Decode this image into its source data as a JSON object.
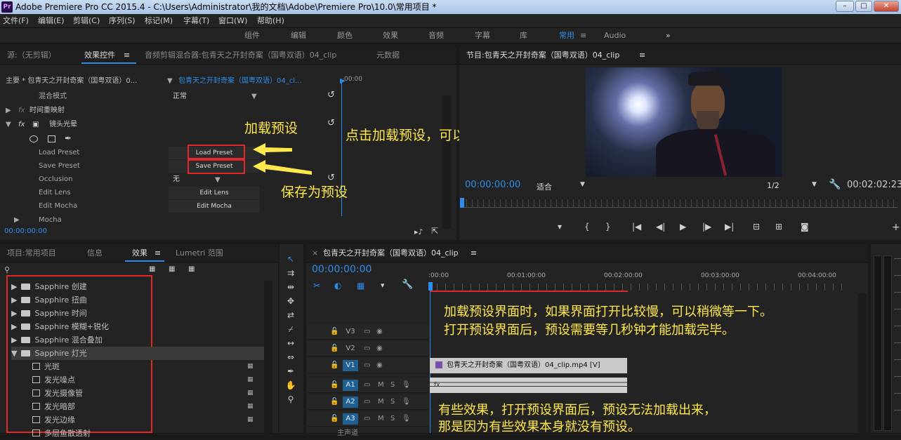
{
  "window": {
    "title": "Adobe Premiere Pro CC 2015.4 - C:\\Users\\Administrator\\我的文档\\Adobe\\Premiere Pro\\10.0\\常用项目 *",
    "logo": "Pr",
    "min": "–",
    "max": "□",
    "close": "✕"
  },
  "menu": [
    "文件(F)",
    "编辑(E)",
    "剪辑(C)",
    "序列(S)",
    "标记(M)",
    "字幕(T)",
    "窗口(W)",
    "帮助(H)"
  ],
  "workspaces": [
    "组件",
    "编辑",
    "颜色",
    "效果",
    "音频",
    "字幕",
    "库",
    "常用",
    "Audio",
    "»"
  ],
  "workspace_active": "常用",
  "top_left": {
    "tabs": [
      "源:（无剪辑）",
      "效果控件",
      "音频剪辑混合器:包青天之开封奇案（国粤双语）04_clip",
      "元数据"
    ],
    "tab_menu": "≡",
    "master_label": "主要 * 包青天之开封奇案（国粤双语）0...",
    "clip_label": "包青天之开封奇案（国粤双语）04_cl...",
    "ruler_time": "00:00",
    "rows": {
      "blend": "混合模式",
      "blend_val": "正常",
      "time_remap": "时间重映射",
      "lens_flare": "镜头光晕",
      "load_preset": "Load Preset",
      "save_preset": "Save Preset",
      "occlusion": "Occlusion",
      "occlusion_val": "无",
      "edit_lens": "Edit Lens",
      "edit_mocha": "Edit Mocha",
      "mocha": "Mocha"
    },
    "buttons": {
      "load": "Load Preset",
      "save": "Save Preset",
      "edit_lens": "Edit Lens",
      "edit_mocha": "Edit Mocha"
    },
    "timecode": "00:00:00:00",
    "fx": "fx"
  },
  "program": {
    "title": "节目:包青天之开封奇案（国粤双语）04_clip",
    "timecode": "00:00:00:00",
    "fit": "适合",
    "res": "1/2",
    "duration": "00:02:02:23"
  },
  "effects_panel": {
    "tabs": [
      "项目:常用项目",
      "信息",
      "效果",
      "Lumetri 范围"
    ],
    "items": [
      {
        "label": "Sapphire 创建",
        "kind": "folder"
      },
      {
        "label": "Sapphire 扭曲",
        "kind": "folder"
      },
      {
        "label": "Sapphire 时间",
        "kind": "folder"
      },
      {
        "label": "Sapphire 模糊+锐化",
        "kind": "folder"
      },
      {
        "label": "Sapphire 混合叠加",
        "kind": "folder"
      },
      {
        "label": "Sapphire 灯光",
        "kind": "folder-open"
      },
      {
        "label": "光斑",
        "kind": "preset"
      },
      {
        "label": "发光噪点",
        "kind": "preset"
      },
      {
        "label": "发光摄像管",
        "kind": "preset"
      },
      {
        "label": "发光暗部",
        "kind": "preset"
      },
      {
        "label": "发光边缘",
        "kind": "preset"
      },
      {
        "label": "多层鱼散透射",
        "kind": "preset"
      }
    ]
  },
  "timeline": {
    "title": "包青天之开封奇案（国粤双语）04_clip",
    "timecode": "00:00:00:00",
    "ruler": [
      ":00:00",
      "00:01:00:00",
      "00:02:00:00",
      "00:03:00:00",
      "00:04:00:00"
    ],
    "tracks": [
      "V3",
      "V2",
      "V1",
      "A1",
      "A2",
      "A3"
    ],
    "video_clip": "包青天之开封奇案（国粤双语）04_clip.mp4 [V]",
    "master": "主声道",
    "audio_clip_label": "fx"
  },
  "annotations": {
    "load": "加载预设",
    "save": "保存为预设",
    "open_lib": "点击加载预设，可以打开模板库",
    "slow1": "加载预设界面时，如果界面打开比较慢，可以稍微等一下。",
    "slow2": "打开预设界面后，预设需要等几秒钟才能加载完毕。",
    "none1": "有些效果，打开预设界面后，预设无法加载出来，",
    "none2": "那是因为有些效果本身就没有预设。"
  },
  "colors": {
    "accent": "#2d8ceb",
    "highlight": "#e02a2a",
    "note": "#ffe84b"
  }
}
